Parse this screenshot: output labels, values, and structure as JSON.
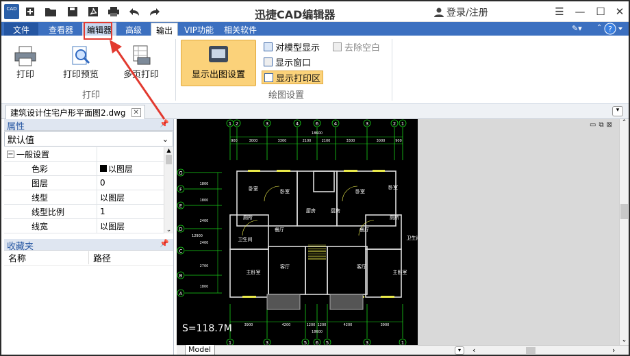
{
  "app": {
    "title": "迅捷CAD编辑器",
    "logo_text": "CAD",
    "login_label": "登录/注册"
  },
  "menu": {
    "file": "文件",
    "tabs": [
      "查看器",
      "编辑器",
      "高级",
      "输出",
      "VIP功能",
      "相关软件"
    ]
  },
  "ribbon": {
    "print_label": "打印",
    "print_preview_label": "打印预览",
    "multipage_print_label": "多页打印",
    "group_print": "打印",
    "display_layout_label": "显示出图设置",
    "model_display_label": "对模型显示",
    "remove_blank_label": "去除空白",
    "display_window_label": "显示窗口",
    "display_print_area_label": "显示打印区",
    "group_drawing": "绘图设置"
  },
  "document": {
    "tab_name": "建筑设计住宅户形平面图2.dwg",
    "layout_tab": "Model"
  },
  "properties": {
    "title": "属性",
    "combo_value": "默认值",
    "section": "一般设置",
    "rows": [
      {
        "key": "色彩",
        "value": "以图层"
      },
      {
        "key": "图层",
        "value": "0"
      },
      {
        "key": "线型",
        "value": "以图层"
      },
      {
        "key": "线型比例",
        "value": "1"
      },
      {
        "key": "线宽",
        "value": "以图层"
      }
    ]
  },
  "favorites": {
    "title": "收藏夹",
    "col_name": "名称",
    "col_path": "路径"
  },
  "drawing": {
    "scale_text": "S=118.7M",
    "axis_top": [
      "1",
      "2",
      "3",
      "4",
      "6",
      "4",
      "3",
      "2",
      "1"
    ],
    "axis_bottom": [
      "1",
      "3",
      "5",
      "6",
      "5",
      "3",
      "1"
    ],
    "axis_left": [
      "G",
      "F",
      "E",
      "D",
      "C",
      "B",
      "A"
    ],
    "dim_top_total": "18600",
    "dims_top": [
      "900",
      "3000",
      "3300",
      "2100",
      "2100",
      "3300",
      "3000",
      "900"
    ],
    "dims_left": [
      "1800",
      "1800",
      "2400",
      "12900",
      "2400",
      "2700",
      "1800"
    ],
    "dims_bottom": [
      "3900",
      "4200",
      "1200",
      "1200",
      "4200",
      "3900"
    ],
    "dim_bottom_total": "18600",
    "rooms": [
      {
        "name": "卧室"
      },
      {
        "name": "卧室"
      },
      {
        "name": "卧室"
      },
      {
        "name": "卧室"
      },
      {
        "name": "厨房"
      },
      {
        "name": "厨房"
      },
      {
        "name": "厕所"
      },
      {
        "name": "厕所"
      },
      {
        "name": "餐厅"
      },
      {
        "name": "餐厅"
      },
      {
        "name": "卫生间"
      },
      {
        "name": "卫生间"
      },
      {
        "name": "客厅"
      },
      {
        "name": "客厅"
      },
      {
        "name": "主卧室"
      },
      {
        "name": "主卧室"
      }
    ]
  },
  "colors": {
    "menu_bg": "#3c70c0",
    "highlight": "#fbd27a",
    "annotation_red": "#e23a30",
    "cad_green": "#19d419",
    "cad_yellow": "#e8e84a"
  }
}
